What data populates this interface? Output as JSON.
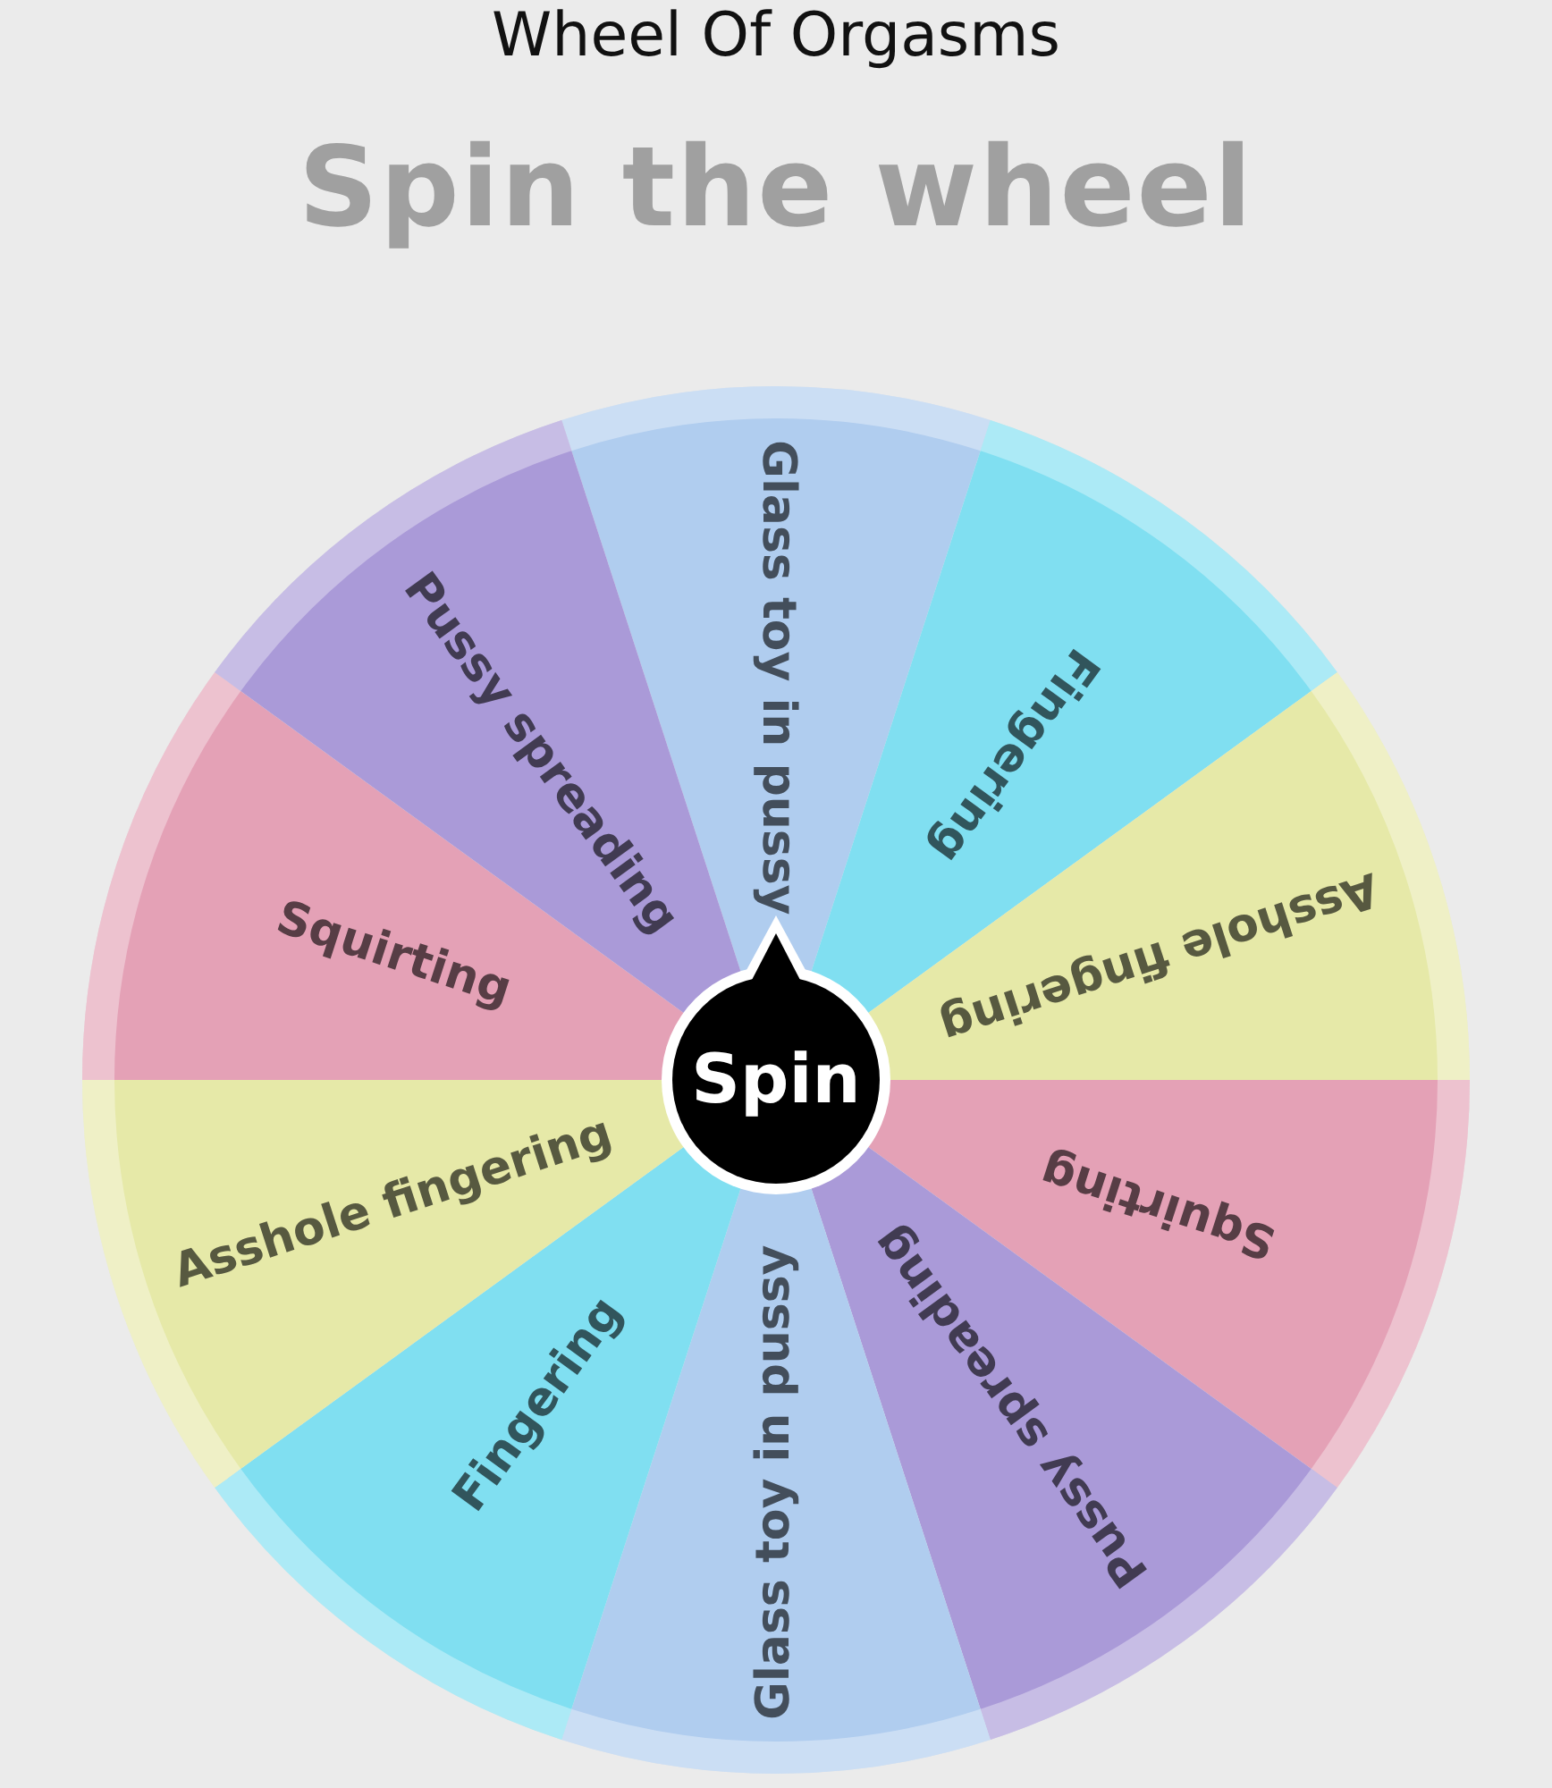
{
  "title": "Wheel Of Orgasms",
  "heading": "Spin the wheel",
  "wheel": {
    "segments": [
      {
        "label": "Glass toy in pussy",
        "color": "#b0cdef"
      },
      {
        "label": "Fingering",
        "color": "#80dff1"
      },
      {
        "label": "Asshole fingering",
        "color": "#e6e9a8"
      },
      {
        "label": "Squirting",
        "color": "#e4a1b6"
      },
      {
        "label": "Pussy spreading",
        "color": "#aa9ad8"
      },
      {
        "label": "Glass toy in pussy",
        "color": "#b0cdef"
      },
      {
        "label": "Fingering",
        "color": "#80dff1"
      },
      {
        "label": "Asshole fingering",
        "color": "#e6e9a8"
      },
      {
        "label": "Squirting",
        "color": "#e4a1b6"
      },
      {
        "label": "Pussy spreading",
        "color": "#aa9ad8"
      }
    ]
  },
  "spin_button": {
    "label": "Spin"
  }
}
